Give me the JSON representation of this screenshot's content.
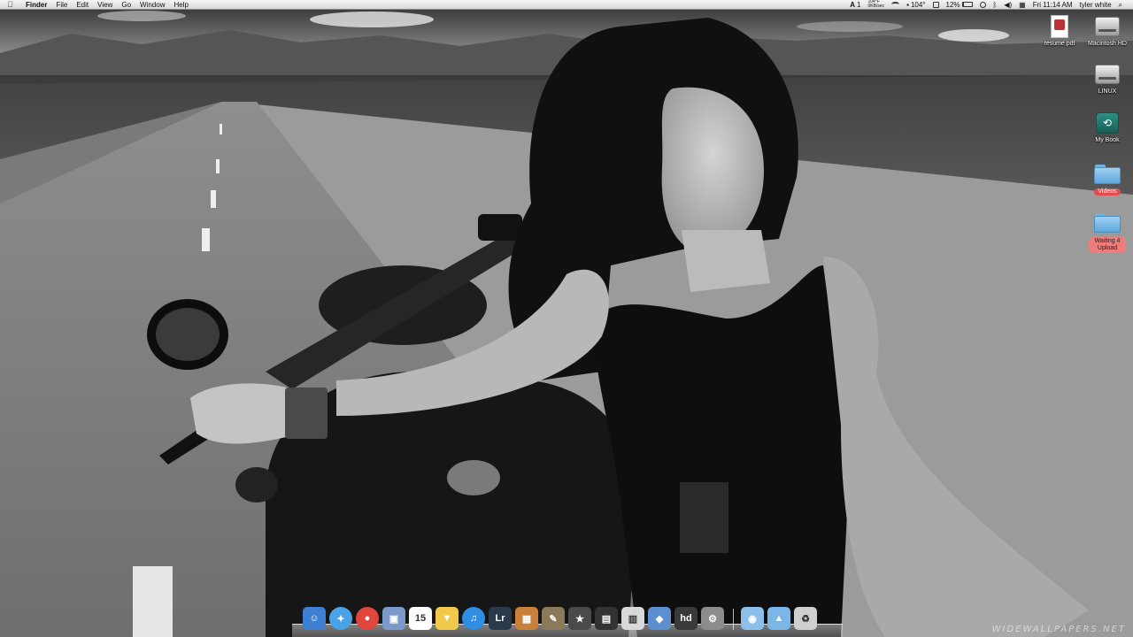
{
  "menubar": {
    "app_name": "Finder",
    "menus": [
      "File",
      "Edit",
      "View",
      "Go",
      "Window",
      "Help"
    ],
    "status": {
      "badge_count": "1",
      "temp_small": "104°F",
      "net_small": "0KB/sec",
      "temperature": "104°",
      "battery_percent": "12%",
      "clock": "Fri 11:14 AM",
      "user": "tyler white"
    }
  },
  "desktop_icons": [
    {
      "label": "resume.pdf",
      "icon": "pdf-document-icon"
    },
    {
      "label": "Macintosh HD",
      "icon": "hard-drive-icon"
    },
    {
      "label": "LINUX",
      "icon": "hard-drive-icon"
    },
    {
      "label": "My Book",
      "icon": "time-machine-drive-icon"
    },
    {
      "label": "Videos",
      "icon": "folder-icon",
      "tag_color": "#e24c4c"
    },
    {
      "label": "Waiting 4 Upload",
      "icon": "folder-icon",
      "tag_color": "#f07b7b"
    }
  ],
  "dock": {
    "apps": [
      {
        "name": "finder-icon",
        "glyph": "☺",
        "color": "#3d7fd1"
      },
      {
        "name": "safari-icon",
        "glyph": "✦",
        "color": "#4aa3e6"
      },
      {
        "name": "chrome-icon",
        "glyph": "●",
        "color": "#e0463b"
      },
      {
        "name": "preview-icon",
        "glyph": "▣",
        "color": "#7a9bc9"
      },
      {
        "name": "calendar-icon",
        "glyph": "15",
        "color": "#ffffff"
      },
      {
        "name": "cyberduck-icon",
        "glyph": "▼",
        "color": "#f2c84b"
      },
      {
        "name": "itunes-icon",
        "glyph": "♫",
        "color": "#2f8de4"
      },
      {
        "name": "lightroom-icon",
        "glyph": "Lr",
        "color": "#2b3a4a"
      },
      {
        "name": "iphoto-icon",
        "glyph": "▦",
        "color": "#c9803a"
      },
      {
        "name": "gimp-icon",
        "glyph": "✎",
        "color": "#8a7a5a"
      },
      {
        "name": "imovie-icon",
        "glyph": "★",
        "color": "#4a4a4a"
      },
      {
        "name": "final-cut-icon",
        "glyph": "▤",
        "color": "#333333"
      },
      {
        "name": "clapboard-icon",
        "glyph": "▥",
        "color": "#d9d9d9"
      },
      {
        "name": "xcode-icon",
        "glyph": "◆",
        "color": "#5b8fd0"
      },
      {
        "name": "hd-app-icon",
        "glyph": "hd",
        "color": "#3a3a3a"
      },
      {
        "name": "settings-app-icon",
        "glyph": "⚙",
        "color": "#8c8c8c"
      },
      {
        "name": "downloads-stack-icon",
        "glyph": "◉",
        "color": "#8cc0ea"
      },
      {
        "name": "applications-folder-icon",
        "glyph": "▲",
        "color": "#7ab6e6"
      },
      {
        "name": "trash-icon",
        "glyph": "♻",
        "color": "#cfcfcf"
      }
    ]
  },
  "wallpaper": {
    "watermark": "WIDEWALLPAPERS.NET"
  }
}
